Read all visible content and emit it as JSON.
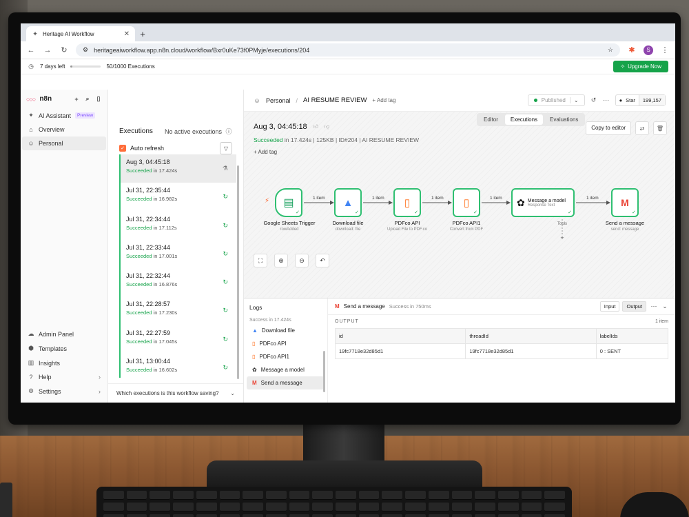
{
  "browser": {
    "tab_title": "Heritage AI Workflow",
    "url": "heritageaiworkflow.app.n8n.cloud/workflow/Bxr0uKe73f0PMyje/executions/204",
    "profile_initial": "S"
  },
  "trial": {
    "days_left": "7 days left",
    "executions": "50/1000 Executions",
    "executions_used_fraction": 0.05,
    "upgrade_label": "Upgrade Now"
  },
  "sidebar": {
    "logo": "n8n",
    "items": [
      {
        "label": "AI Assistant",
        "badge": "Preview"
      },
      {
        "label": "Overview"
      },
      {
        "label": "Personal"
      }
    ],
    "bottom_items": [
      {
        "label": "Admin Panel"
      },
      {
        "label": "Templates"
      },
      {
        "label": "Insights"
      },
      {
        "label": "Help"
      },
      {
        "label": "Settings"
      }
    ]
  },
  "executions_panel": {
    "title": "Executions",
    "active_status": "No active executions",
    "auto_refresh_label": "Auto refresh",
    "auto_refresh_checked": true,
    "items": [
      {
        "date": "Aug 3, 04:45:18",
        "status": "Succeeded",
        "duration": "in 17.424s"
      },
      {
        "date": "Jul 31, 22:35:44",
        "status": "Succeeded",
        "duration": "in 16.982s"
      },
      {
        "date": "Jul 31, 22:34:44",
        "status": "Succeeded",
        "duration": "in 17.112s"
      },
      {
        "date": "Jul 31, 22:33:44",
        "status": "Succeeded",
        "duration": "in 17.001s"
      },
      {
        "date": "Jul 31, 22:32:44",
        "status": "Succeeded",
        "duration": "in 16.876s"
      },
      {
        "date": "Jul 31, 22:28:57",
        "status": "Succeeded",
        "duration": "in 17.230s"
      },
      {
        "date": "Jul 31, 22:27:59",
        "status": "Succeeded",
        "duration": "in 17.045s"
      },
      {
        "date": "Jul 31, 13:00:44",
        "status": "Succeeded",
        "duration": "in 16.602s"
      }
    ],
    "footer_question": "Which executions is this workflow saving?"
  },
  "header": {
    "breadcrumb_root": "Personal",
    "workflow_name": "AI RESUME REVIEW",
    "add_tag": "+ Add tag",
    "published_label": "Published",
    "star_label": "Star",
    "star_count": "199,157"
  },
  "view_tabs": [
    "Editor",
    "Executions",
    "Evaluations"
  ],
  "execution": {
    "date": "Aug 3, 04:45:18",
    "status": "Succeeded",
    "meta": "in 17.424s | 125KB | ID#204 | AI RESUME REVIEW",
    "add_tag": "+ Add tag",
    "copy_button": "Copy to editor"
  },
  "workflow": {
    "nodes": [
      {
        "name": "Google Sheets Trigger",
        "sub": "rowAdded",
        "icon": "google-sheets-icon"
      },
      {
        "name": "Download file",
        "sub": "download: file",
        "icon": "google-drive-icon"
      },
      {
        "name": "PDFco API",
        "sub": "Upload File to PDF.co",
        "icon": "pdfco-icon"
      },
      {
        "name": "PDFco API1",
        "sub": "Convert from PDF",
        "icon": "pdfco-icon"
      },
      {
        "name": "Message a model",
        "sub": "Response Text",
        "icon": "openai-icon",
        "extra_label": "Tools"
      },
      {
        "name": "Send a message",
        "sub": "send: message",
        "icon": "gmail-icon"
      }
    ],
    "edge_label": "1 item",
    "colors": {
      "success": "#2fbf71",
      "trigger": "#ff6d3a",
      "sheets": "#0f9d58",
      "pdfco": "#ff6a13",
      "gmail": "#ea4335"
    }
  },
  "logs": {
    "title": "Logs",
    "summary": "Success in 17.424s",
    "items": [
      "Download file",
      "PDFco API",
      "PDFco API1",
      "Message a model",
      "Send a message"
    ],
    "selected": {
      "name": "Send a message",
      "status": "Success in 750ms",
      "input_tab": "Input",
      "output_tab": "Output",
      "output_label": "OUTPUT",
      "item_count": "1 item",
      "columns": [
        "id",
        "threadId",
        "labelIds"
      ],
      "row": [
        "19fc7718e32d85d1",
        "19fc7718e32d85d1",
        "0 : SENT"
      ]
    }
  }
}
